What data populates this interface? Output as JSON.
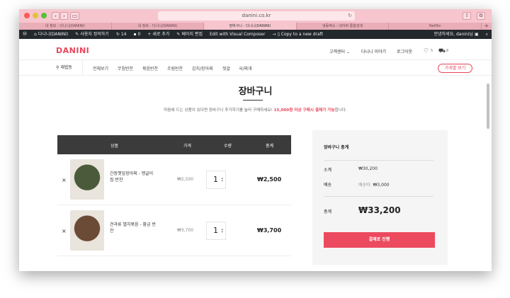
{
  "browser": {
    "url": "danini.co.kr",
    "tabs": [
      {
        "label": "내 정보 - 다니니(DANINI)",
        "active": false
      },
      {
        "label": "내 정보 - 다니니(DANINI)",
        "active": false
      },
      {
        "label": "장바구니 - 다니니(DANINI)",
        "active": true
      },
      {
        "label": "냉동떡소 : 네이버 통합검색",
        "active": false
      },
      {
        "label": "Netflix",
        "active": false
      }
    ]
  },
  "adminbar": {
    "site": "다니니(DANINI)",
    "customize": "사용자 정의하기",
    "updates": "14",
    "comments": "0",
    "new": "새로 추가",
    "edit": "페이지 편집",
    "composer": "Edit with Visual Composer",
    "draft": "Copy to a new draft",
    "greeting": "안녕하세요, danini님"
  },
  "header": {
    "logo": "DANINI",
    "customer_center": "고객센터",
    "story": "다니니 이야기",
    "logout": "로그아웃",
    "wish_count": "5",
    "cart_count": "8"
  },
  "categories": {
    "location": "재법동",
    "items": [
      "전체보기",
      "무침반찬",
      "볶음반찬",
      "조림반찬",
      "김치/장아찌",
      "젓갈",
      "국/찌개"
    ],
    "store_button": "가게별 보기"
  },
  "page": {
    "title": "장바구니",
    "subtitle_prefix": "마음에 드는 상품이 있다면 장바구니 추가하기를 눌러 구매하세요! ",
    "subtitle_highlight": "15,000원 이상 구매시 결제가 가능",
    "subtitle_suffix": "합니다."
  },
  "table": {
    "headers": {
      "product": "상품",
      "price": "가격",
      "quantity": "수량",
      "subtotal": "총계"
    },
    "rows": [
      {
        "name": "간장깻잎장아찌 - 맹글이집 반찬",
        "price": "₩2,500",
        "qty": "1",
        "subtotal": "₩2,500",
        "color": "#4a5a3a"
      },
      {
        "name": "견과류 멸치볶음 - 황금 반찬",
        "price": "₩3,700",
        "qty": "1",
        "subtotal": "₩3,700",
        "color": "#6b4a36"
      }
    ]
  },
  "summary": {
    "title": "장바구니 총계",
    "subtotal_label": "소계",
    "subtotal_value": "₩30,200",
    "shipping_label": "배송",
    "shipping_prefix": "배송비: ",
    "shipping_value": "₩3,000",
    "total_label": "총계",
    "total_value": "₩33,200",
    "checkout": "결제로 진행"
  },
  "colors": {
    "accent": "#e8455a",
    "titlebar": "#f6c5cd",
    "adminbar": "#23282d",
    "table_head": "#3b3b3b"
  }
}
